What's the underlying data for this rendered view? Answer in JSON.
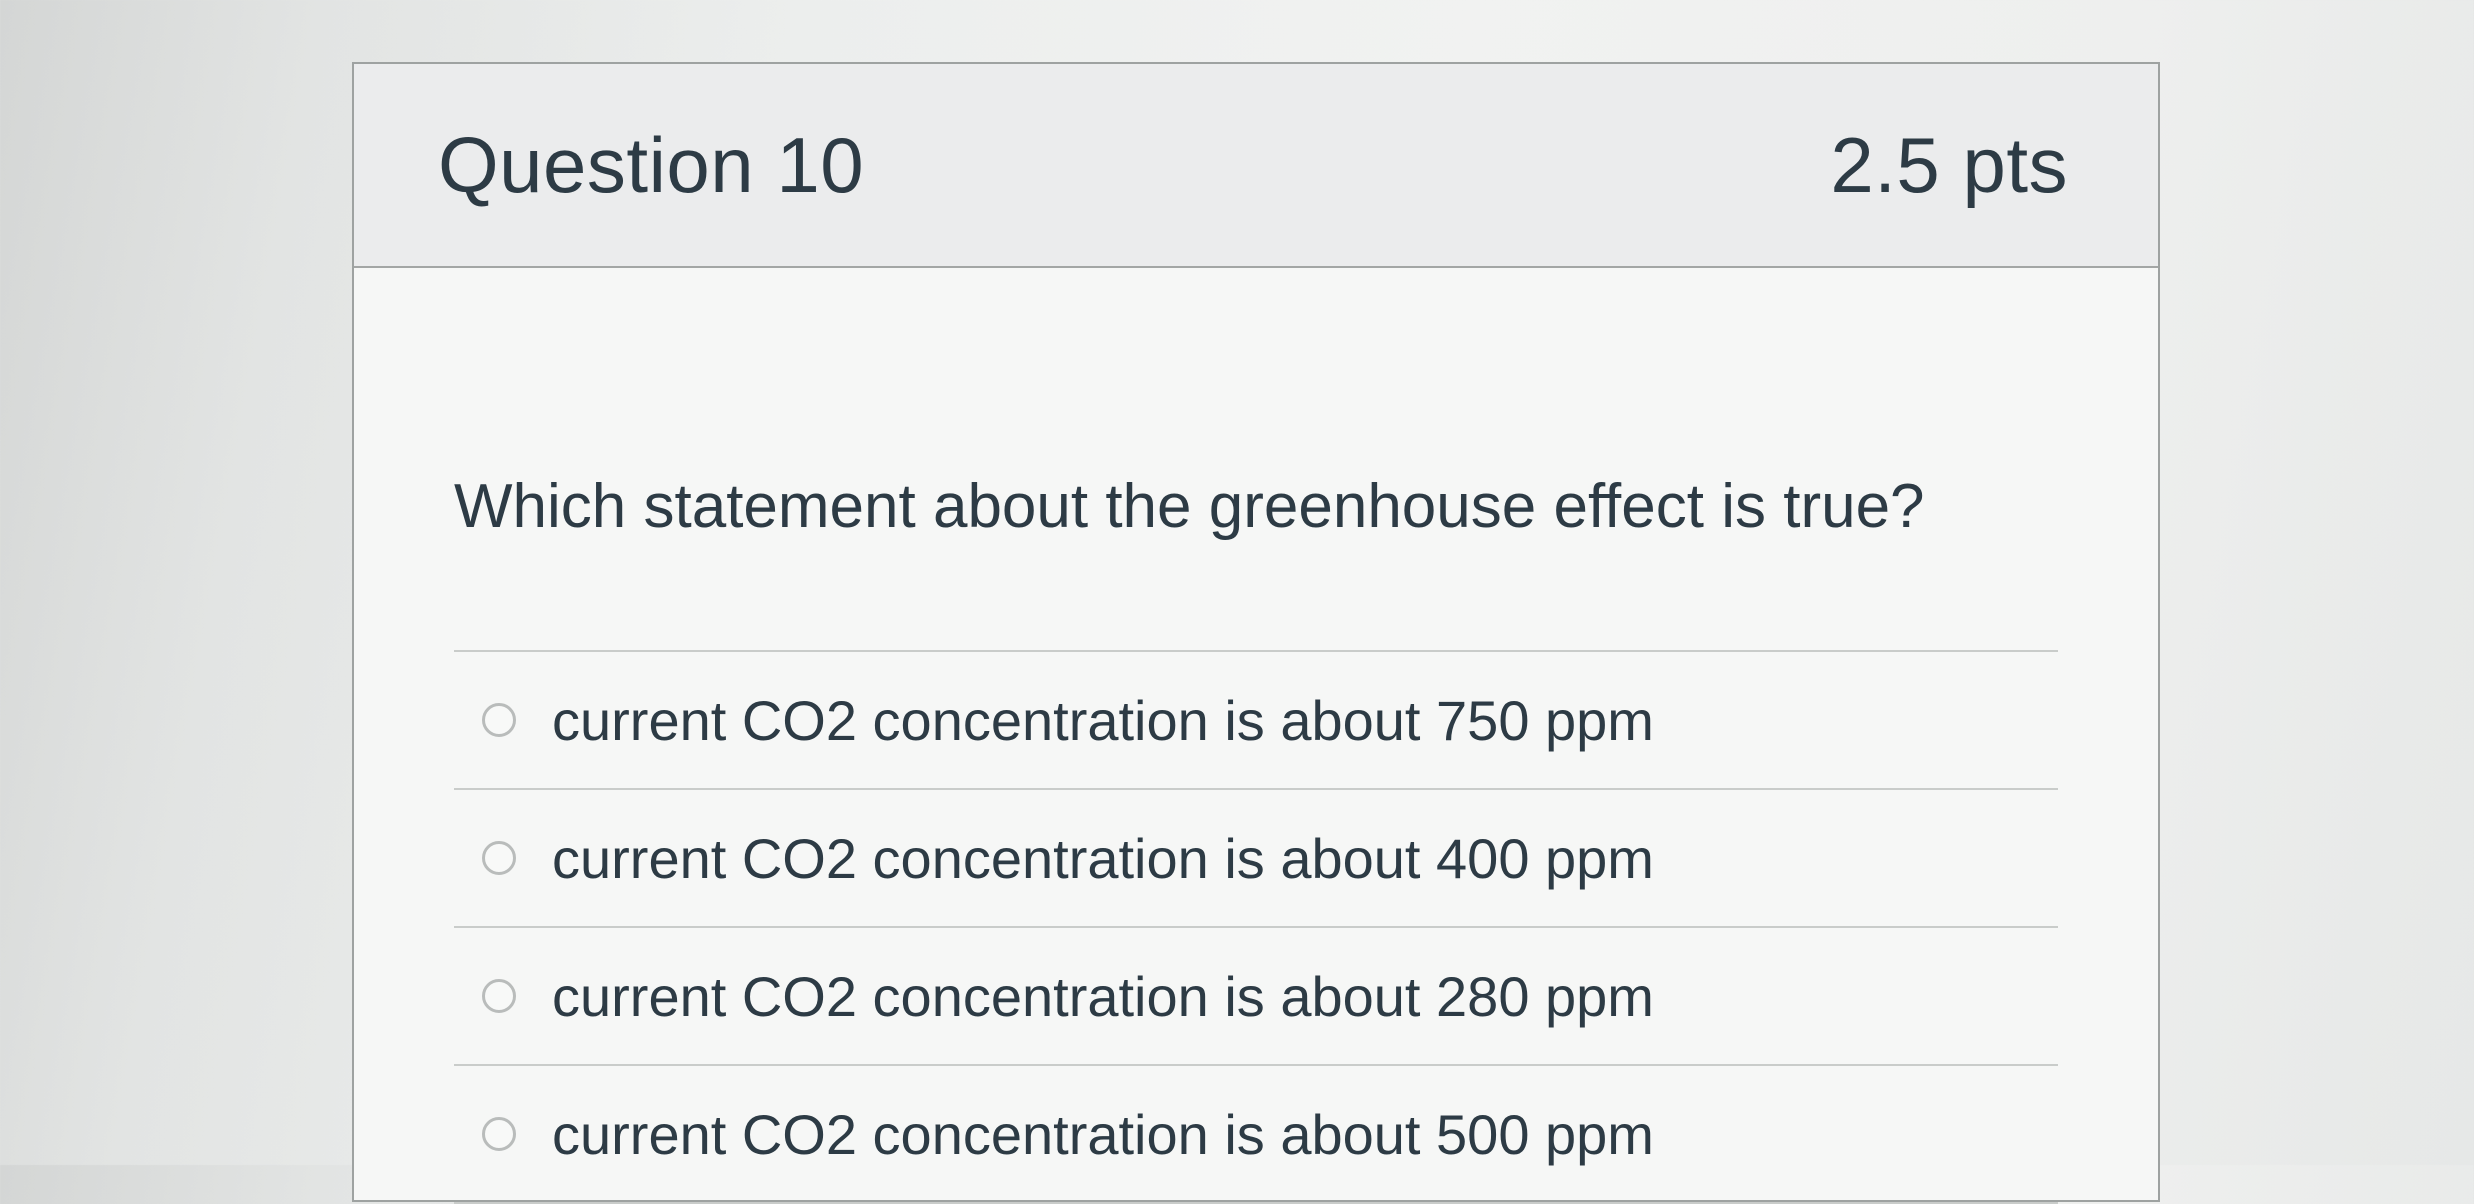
{
  "question": {
    "title": "Question 10",
    "points": "2.5 pts",
    "text": "Which statement about the greenhouse effect is true?"
  },
  "answers": [
    {
      "label": "current CO2 concentration is about 750 ppm",
      "selected": false
    },
    {
      "label": "current CO2 concentration is about 400 ppm",
      "selected": false
    },
    {
      "label": "current CO2 concentration is about 280 ppm",
      "selected": false
    },
    {
      "label": "current CO2 concentration is about 500 ppm",
      "selected": false
    }
  ],
  "colors": {
    "text": "#2d3b45",
    "header_bg": "#ebeced",
    "border": "#a3a6a5"
  }
}
